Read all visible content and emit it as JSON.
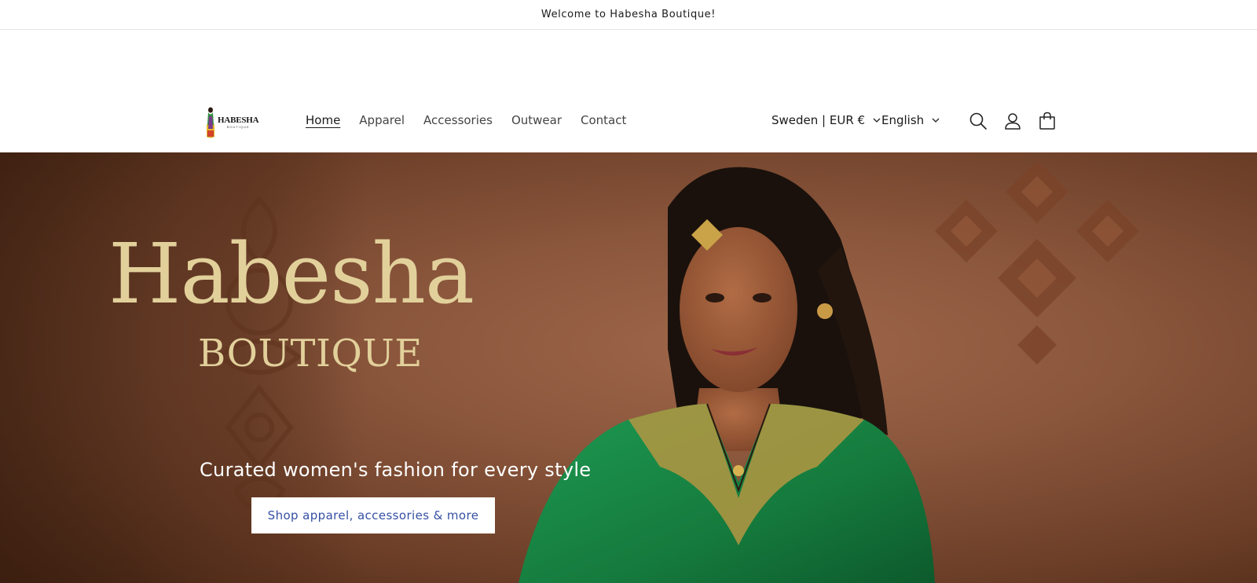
{
  "announcement": "Welcome to Habesha Boutique!",
  "logo": {
    "word": "HABESHA",
    "sub": "BOUTIQUE",
    "icon": "habesha-woman-logo"
  },
  "nav": [
    {
      "label": "Home",
      "active": true
    },
    {
      "label": "Apparel"
    },
    {
      "label": "Accessories"
    },
    {
      "label": "Outwear"
    },
    {
      "label": "Contact"
    }
  ],
  "locale": {
    "country": "Sweden | EUR €",
    "language": "English"
  },
  "header_icons": [
    "search-icon",
    "account-icon",
    "cart-icon"
  ],
  "hero": {
    "title": "Habesha",
    "subtitle": "BOUTIQUE",
    "tagline": "Curated women's fashion for every style",
    "cta": "Shop apparel, accessories & more"
  },
  "colors": {
    "gold": "#e2d09b",
    "cta_text": "#3550a3",
    "dress": "#1a8a4a",
    "hero_bg": "#8a563c"
  }
}
